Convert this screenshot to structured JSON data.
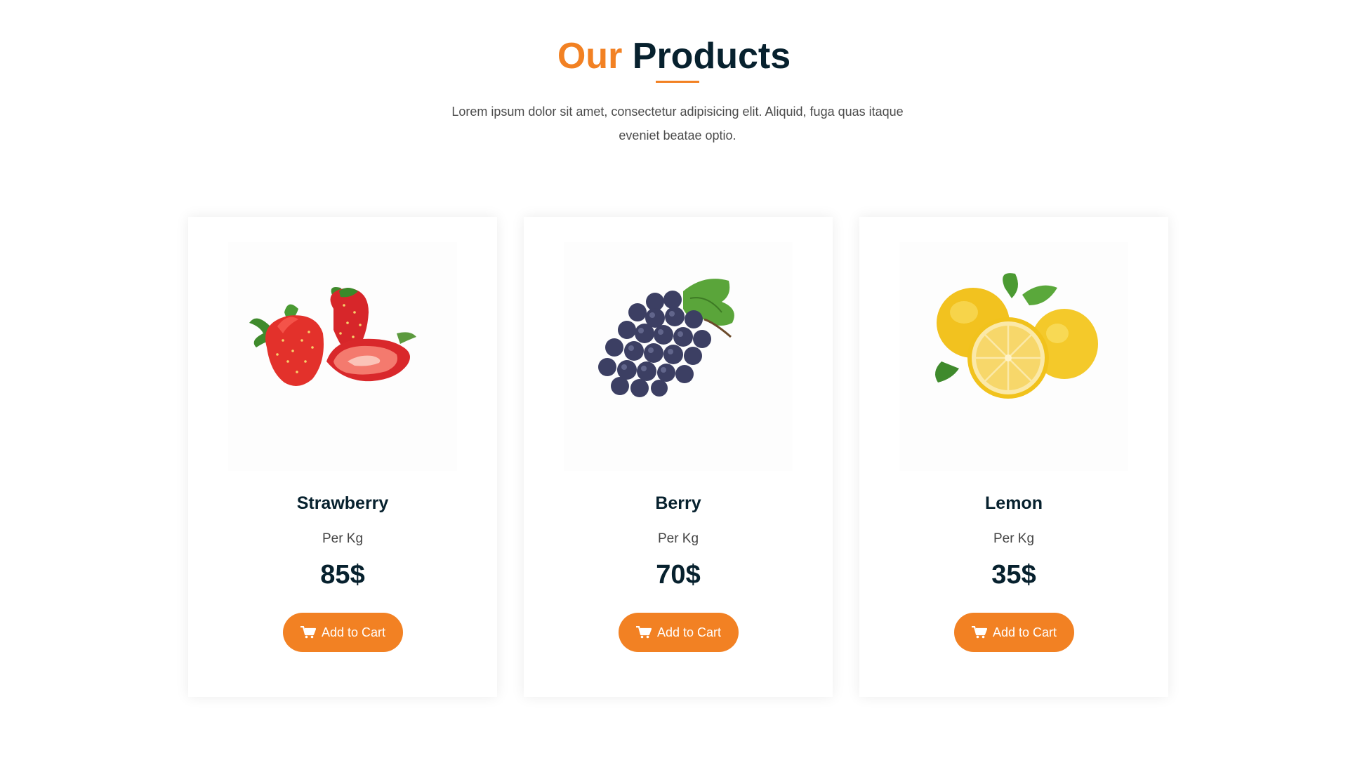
{
  "header": {
    "title_accent": "Our",
    "title_rest": "Products",
    "description": "Lorem ipsum dolor sit amet, consectetur adipisicing elit. Aliquid, fuga quas itaque eveniet beatae optio."
  },
  "colors": {
    "accent": "#f28123",
    "heading": "#07212e"
  },
  "products": [
    {
      "name": "Strawberry",
      "unit": "Per Kg",
      "price": "85$",
      "button_label": "Add to Cart",
      "button_icon": "shopping-cart-icon",
      "image": "strawberry-image"
    },
    {
      "name": "Berry",
      "unit": "Per Kg",
      "price": "70$",
      "button_label": "Add to Cart",
      "button_icon": "shopping-cart-icon",
      "image": "grapes-image"
    },
    {
      "name": "Lemon",
      "unit": "Per Kg",
      "price": "35$",
      "button_label": "Add to Cart",
      "button_icon": "shopping-cart-icon",
      "image": "lemon-image"
    }
  ]
}
